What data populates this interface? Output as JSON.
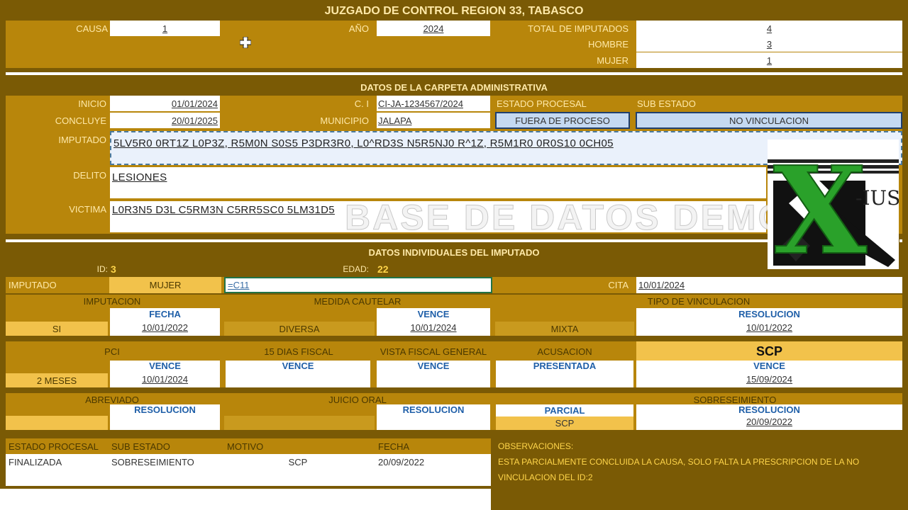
{
  "title": "JUZGADO DE CONTROL REGION 33, TABASCO",
  "top": {
    "causa_label": "CAUSA",
    "causa_value": "1",
    "anio_label": "AÑO",
    "anio_value": "2024",
    "total_label": "TOTAL DE IMPUTADOS",
    "total_value": "4",
    "hombre_label": "HOMBRE",
    "hombre_value": "3",
    "mujer_label": "MUJER",
    "mujer_value": "1"
  },
  "carpeta": {
    "header": "DATOS DE LA CARPETA ADMINISTRATIVA",
    "inicio_label": "INICIO",
    "inicio_value": "01/01/2024",
    "ci_label": "C. I",
    "ci_value": "CI-JA-1234567/2024",
    "estado_label": "ESTADO PROCESAL",
    "estado_value": "FUERA DE PROCESO",
    "subestado_label": "SUB ESTADO",
    "subestado_value": "NO VINCULACION",
    "concluye_label": "CONCLUYE",
    "concluye_value": "20/01/2025",
    "municipio_label": "MUNICIPIO",
    "municipio_value": "JALAPA",
    "imputado_label": "IMPUTADO",
    "imputado_value": "5LV5R0 0RT1Z L0P3Z, R5M0N S0S5 P3DR3R0, L0^RD3S N5R5NJ0 R^1Z, R5M1R0 0R0S10 0CH05",
    "delito_label": "DELITO",
    "delito_value": "LESIONES",
    "victima_label": "VICTIMA",
    "victima_value": "L0R3N5 D3L C5RM3N C5RR5SC0 5LM31D5",
    "watermark": "BASE DE DATOS DEMO"
  },
  "logo": {
    "letter": "X",
    "text": "-IUS"
  },
  "individual": {
    "header": "DATOS INDIVIDUALES DEL IMPUTADO",
    "id_label": "ID:",
    "id_value": "3",
    "edad_label": "EDAD:",
    "edad_value": "22",
    "imputado_label": "IMPUTADO",
    "sexo_value": "MUJER",
    "formula_value": "=C11",
    "cita_label": "CITA",
    "cita_value": "10/01/2024",
    "imputacion_label": "IMPUTACION",
    "imputacion_value": "SI",
    "imputacion_sub": "FECHA",
    "imputacion_fecha": "10/01/2022",
    "medida_label": "MEDIDA CAUTELAR",
    "medida_value": "DIVERSA",
    "medida_sub": "VENCE",
    "medida_fecha": "10/01/2024",
    "tipo_label": "TIPO DE VINCULACION",
    "tipo_value": "MIXTA",
    "tipo_sub": "RESOLUCION",
    "tipo_fecha": "10/01/2022",
    "pci_label": "PCI",
    "pci_value": "2 MESES",
    "pci_sub": "VENCE",
    "pci_fecha": "10/01/2024",
    "fiscal15_label": "15 DIAS FISCAL",
    "fiscal15_sub": "VENCE",
    "vista_label": "VISTA FISCAL GENERAL",
    "vista_sub": "VENCE",
    "acusacion_label": "ACUSACION",
    "acusacion_sub": "PRESENTADA",
    "scp_label": "SCP",
    "scp_sub": "VENCE",
    "scp_fecha": "15/09/2024",
    "abreviado_label": "ABREVIADO",
    "abreviado_sub": "RESOLUCION",
    "juicio_label": "JUICIO ORAL",
    "juicio_sub": "RESOLUCION",
    "sobre_label": "SOBRESEIMIENTO",
    "sobre_parcial": "PARCIAL",
    "sobre_tipo": "SCP",
    "sobre_sub": "RESOLUCION",
    "sobre_fecha": "20/09/2022"
  },
  "final": {
    "estado_label": "ESTADO PROCESAL",
    "sub_label": "SUB ESTADO",
    "motivo_label": "MOTIVO",
    "fecha_label": "FECHA",
    "estado_value": "FINALIZADA",
    "sub_value": "SOBRESEIMIENTO",
    "motivo_value": "SCP",
    "fecha_value": "20/09/2022",
    "obs_label": "OBSERVACIONES:",
    "obs_value": "ESTA PARCIALMENTE CONCLUIDA LA CAUSA, SOLO FALTA LA PRESCRIPCION DE LA NO VINCULACION DEL ID:2"
  }
}
